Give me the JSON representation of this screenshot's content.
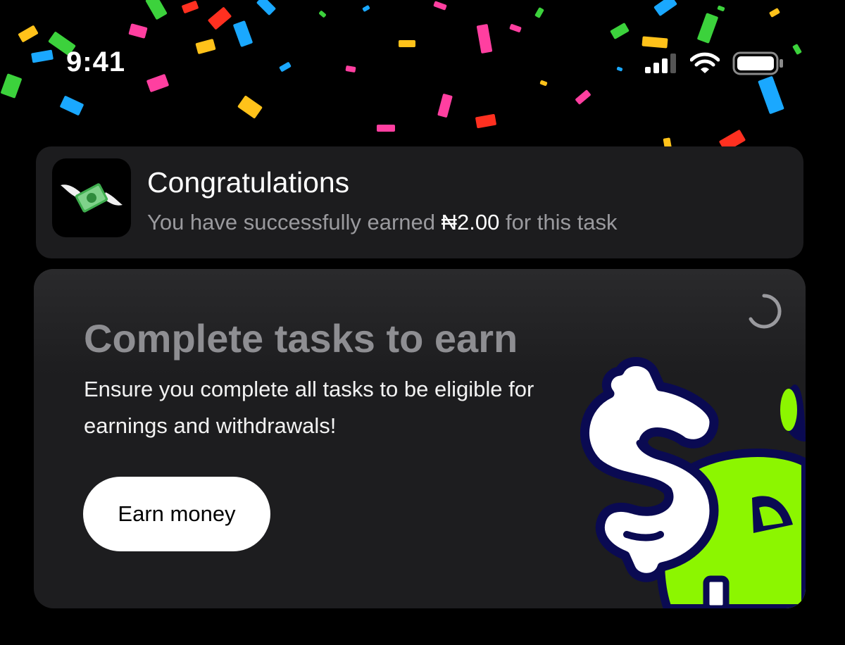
{
  "status_bar": {
    "time": "9:41"
  },
  "toast": {
    "title": "Congratulations",
    "message_prefix": "You have successfully earned ",
    "amount": "₦2.00",
    "message_suffix": " for this task",
    "icon": "money-with-wings-icon"
  },
  "card": {
    "title": "Complete tasks to earn",
    "description": "Ensure you complete all tasks to be eligible for earnings and withdrawals!",
    "button_label": "Earn money",
    "spinner_icon": "loading-spinner-icon",
    "illustration": "dollar-mascot-illustration"
  },
  "colors": {
    "background": "#000000",
    "surface": "#1c1c1e",
    "accent_green": "#8cf600",
    "outline_navy": "#0a0a52"
  }
}
